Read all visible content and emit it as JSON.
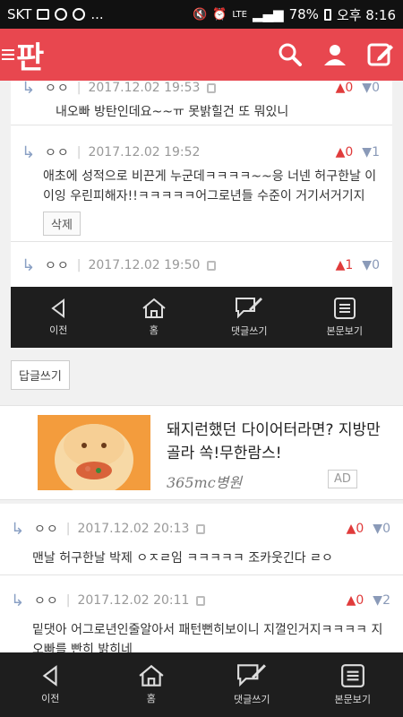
{
  "status": {
    "carrier": "SKT",
    "notif_more": "...",
    "network": "LTE",
    "battery": "78%",
    "time": "오후 8:16"
  },
  "app": {
    "logo": "판"
  },
  "comments_top": [
    {
      "author": "ㅇㅇ",
      "date": "2017.12.02 19:53",
      "up": "0",
      "down": "0",
      "text": "내오빠 방탄인데요~~ㅠ 못밝힐건 또 뭐있니"
    },
    {
      "author": "ㅇㅇ",
      "date": "2017.12.02 19:52",
      "up": "0",
      "down": "1",
      "text": "애초에 성적으로 비끈게 누군데ㅋㅋㅋㅋ~~응 너넨 허구한날 이이잉 우린피해자!!ㅋㅋㅋㅋㅋ어그로년들 수준이 거기서거기지",
      "delete_label": "삭제"
    },
    {
      "author": "ㅇㅇ",
      "date": "2017.12.02 19:50",
      "up": "1",
      "down": "0",
      "text": ""
    }
  ],
  "overlay_nav": [
    {
      "label": "이전"
    },
    {
      "label": "홈"
    },
    {
      "label": "댓글쓰기"
    },
    {
      "label": "본문보기"
    }
  ],
  "write_reply_label": "답글쓰기",
  "ad": {
    "title": "돼지런했던 다이어터라면? 지방만 골라 쏙!무한람스!",
    "brand": "365mc병원",
    "badge": "AD"
  },
  "comments_bottom": [
    {
      "author": "ㅇㅇ",
      "date": "2017.12.02 20:13",
      "up": "0",
      "down": "0",
      "text": "맨날 허구한날 박제 ㅇㅈㄹ임 ㅋㅋㅋㅋㅋ 조카웃긴다 ㄹㅇ"
    },
    {
      "author": "ㅇㅇ",
      "date": "2017.12.02 20:11",
      "up": "0",
      "down": "2",
      "text": "밑댓아 어그로년인줄알아서 패턴뻔히보이니 지껄인거지ㅋㅋㅋㅋ 지오빠를 빤히 밝히네"
    }
  ],
  "bottom_nav": [
    {
      "label": "이전"
    },
    {
      "label": "홈"
    },
    {
      "label": "댓글쓰기"
    },
    {
      "label": "본문보기"
    }
  ]
}
